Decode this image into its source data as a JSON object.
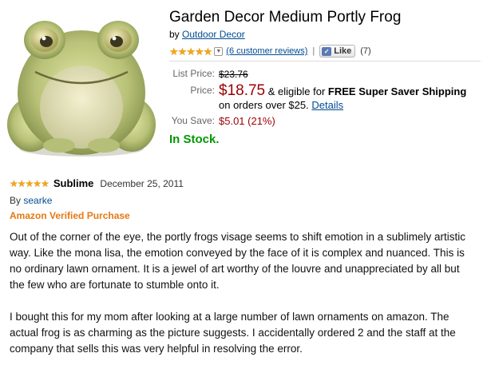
{
  "product": {
    "title": "Garden Decor Medium Portly Frog",
    "by_prefix": "by",
    "brand": "Outdoor Decor",
    "rating_stars": 5,
    "reviews_link": "(6 customer reviews)",
    "separator": "|",
    "like_label": "Like",
    "like_count": "(7)",
    "image_icon": "frog-product-photo"
  },
  "pricing": {
    "list_label": "List Price:",
    "list_value": "$23.76",
    "price_label": "Price:",
    "price_value": "$18.75",
    "eligible_text": "& eligible for",
    "free_shipping": "FREE Super Saver Shipping",
    "orders_text": "on orders over $25.",
    "details_link": "Details",
    "save_label": "You Save:",
    "save_value": "$5.01 (21%)",
    "stock": "In Stock."
  },
  "review": {
    "stars": 5,
    "title": "Sublime",
    "date": "December 25, 2011",
    "by_prefix": "By",
    "author": "searke",
    "verified": "Amazon Verified Purchase",
    "paragraphs": [
      "Out of the corner of the eye, the portly frogs visage seems to shift emotion in a sublimely artistic way. Like the mona lisa, the emotion conveyed by the face of it is complex and nuanced. This is no ordinary lawn ornament. It is a jewel of art worthy of the louvre and unappreciated by all but the few who are fortunate to stumble onto it.",
      "I bought this for my mom after looking at a large number of lawn ornaments on amazon. The actual frog is as charming as the picture suggests. I accidentally ordered 2 and the staff at the company that sells this was very helpful in resolving the error."
    ]
  },
  "colors": {
    "link": "#004b91",
    "price": "#990000",
    "stock": "#009900",
    "verified": "#e47911",
    "star": "#f3a51a"
  }
}
